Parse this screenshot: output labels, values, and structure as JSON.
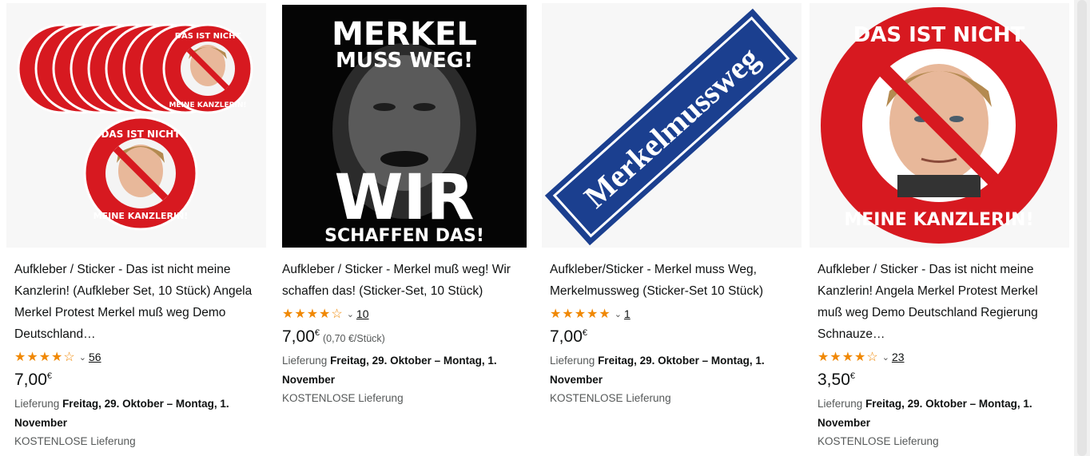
{
  "products": [
    {
      "title": "Aufkleber / Sticker - Das ist nicht meine Kanzlerin! (Aufkleber Set, 10 Stück) Angela Merkel Protest Merkel muß weg Demo Deutschland…",
      "stars": "★★★★☆",
      "rating_count": "56",
      "price": "7,00",
      "currency": "€",
      "unit_price": "",
      "delivery_label": "Lieferung",
      "delivery_date": "Freitag, 29. Oktober – Montag, 1. November",
      "shipping": "KOSTENLOSE Lieferung",
      "sticker_top": "DAS IST NICHT",
      "sticker_bottom": "MEINE KANZLERIN!"
    },
    {
      "title": "Aufkleber / Sticker - Merkel muß weg! Wir schaffen das! (Sticker-Set, 10 Stück)",
      "stars": "★★★★☆",
      "rating_count": "10",
      "price": "7,00",
      "currency": "€",
      "unit_price": "(0,70 €/Stück)",
      "delivery_label": "Lieferung",
      "delivery_date": "Freitag, 29. Oktober – Montag, 1. November",
      "shipping": "KOSTENLOSE Lieferung",
      "poster_line1": "MERKEL",
      "poster_line2": "MUSS WEG!",
      "poster_line3": "WIR",
      "poster_line4": "SCHAFFEN DAS!"
    },
    {
      "title": "Aufkleber/Sticker - Merkel muss Weg, Merkelmussweg (Sticker-Set 10 Stück)",
      "stars": "★★★★★",
      "rating_count": "1",
      "price": "7,00",
      "currency": "€",
      "unit_price": "",
      "delivery_label": "Lieferung",
      "delivery_date": "Freitag, 29. Oktober – Montag, 1. November",
      "shipping": "KOSTENLOSE Lieferung",
      "sign_text": "Merkelmussweg"
    },
    {
      "title": "Aufkleber / Sticker - Das ist nicht meine Kanzlerin! Angela Merkel Protest Merkel muß weg Demo Deutschland Regierung Schnauze…",
      "stars": "★★★★☆",
      "rating_count": "23",
      "price": "3,50",
      "currency": "€",
      "unit_price": "",
      "delivery_label": "Lieferung",
      "delivery_date": "Freitag, 29. Oktober – Montag, 1. November",
      "shipping": "KOSTENLOSE Lieferung",
      "sticker_top": "DAS IST NICHT",
      "sticker_bottom": "MEINE KANZLERIN!"
    }
  ],
  "colors": {
    "star": "#f08804",
    "sticker_red": "#d71920",
    "sign_blue": "#1b3f8f"
  }
}
